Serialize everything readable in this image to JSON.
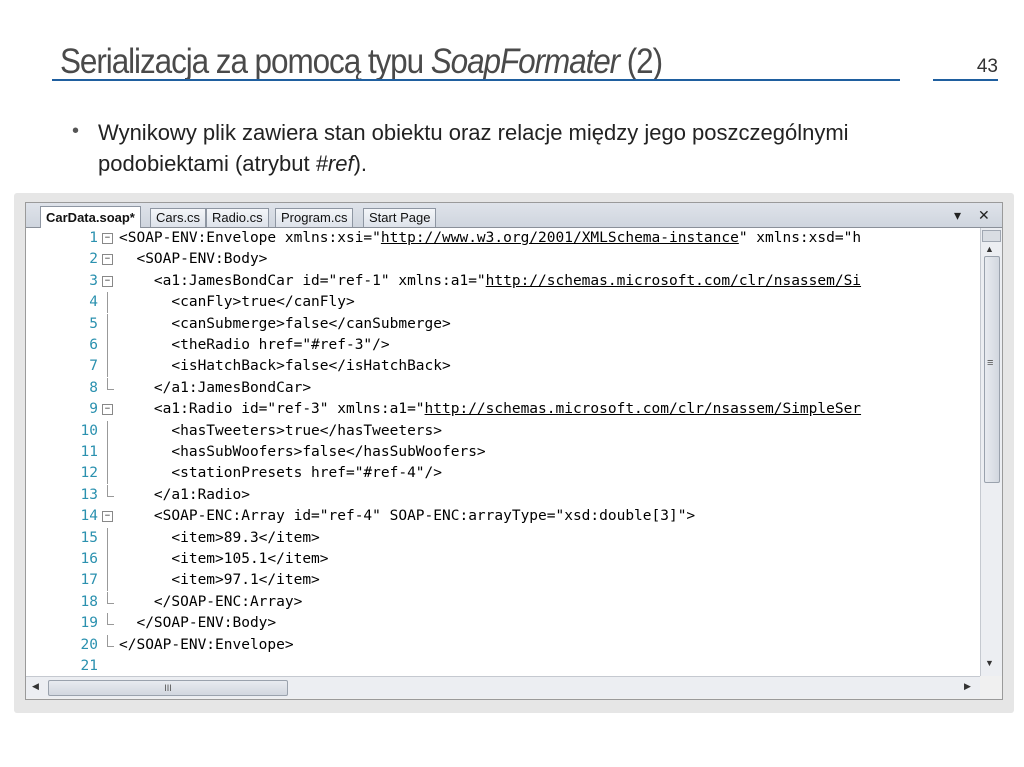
{
  "slide": {
    "title_plain_1": "Serializacja za pomocą typu ",
    "title_italic": "SoapFormater",
    "title_plain_2": " (2)",
    "slide_number": "43",
    "bullet_marker": "•",
    "bullet_text_1": "Wynikowy plik zawiera stan obiektu oraz relacje między jego poszczególnymi podobiektami (atrybut ",
    "bullet_italic": "#ref",
    "bullet_text_2": ")."
  },
  "editor": {
    "tabs": [
      {
        "label": "CarData.soap*",
        "active": true
      },
      {
        "label": "Cars.cs",
        "active": false
      },
      {
        "label": "Radio.cs",
        "active": false
      },
      {
        "label": "Program.cs",
        "active": false
      },
      {
        "label": "Start Page",
        "active": false
      }
    ],
    "dropdown_glyph": "▾",
    "close_glyph": "✕",
    "hscroll_grip": "III",
    "vscroll_grip": "≡",
    "lines": [
      {
        "n": "1",
        "pre": "<SOAP-ENV:Envelope xmlns:xsi=\"",
        "url": "http://www.w3.org/2001/XMLSchema-instance",
        "post": "\" xmlns:xsd=\"h",
        "fold": "minus"
      },
      {
        "n": "2",
        "pre": "  <SOAP-ENV:Body>",
        "fold": "minus"
      },
      {
        "n": "3",
        "pre": "    <a1:JamesBondCar id=\"ref-1\" xmlns:a1=\"",
        "url": "http://schemas.microsoft.com/clr/nsassem/Si",
        "fold": "minus"
      },
      {
        "n": "4",
        "pre": "      <canFly>true</canFly>"
      },
      {
        "n": "5",
        "pre": "      <canSubmerge>false</canSubmerge>"
      },
      {
        "n": "6",
        "pre": "      <theRadio href=\"#ref-3\"/>"
      },
      {
        "n": "7",
        "pre": "      <isHatchBack>false</isHatchBack>"
      },
      {
        "n": "8",
        "pre": "    </a1:JamesBondCar>",
        "fold": "end"
      },
      {
        "n": "9",
        "pre": "    <a1:Radio id=\"ref-3\" xmlns:a1=\"",
        "url": "http://schemas.microsoft.com/clr/nsassem/SimpleSer",
        "fold": "minus"
      },
      {
        "n": "10",
        "pre": "      <hasTweeters>true</hasTweeters>"
      },
      {
        "n": "11",
        "pre": "      <hasSubWoofers>false</hasSubWoofers>"
      },
      {
        "n": "12",
        "pre": "      <stationPresets href=\"#ref-4\"/>"
      },
      {
        "n": "13",
        "pre": "    </a1:Radio>",
        "fold": "end"
      },
      {
        "n": "14",
        "pre": "    <SOAP-ENC:Array id=\"ref-4\" SOAP-ENC:arrayType=\"xsd:double[3]\">",
        "fold": "minus"
      },
      {
        "n": "15",
        "pre": "      <item>89.3</item>"
      },
      {
        "n": "16",
        "pre": "      <item>105.1</item>"
      },
      {
        "n": "17",
        "pre": "      <item>97.1</item>"
      },
      {
        "n": "18",
        "pre": "    </SOAP-ENC:Array>",
        "fold": "end"
      },
      {
        "n": "19",
        "pre": "  </SOAP-ENV:Body>",
        "fold": "end"
      },
      {
        "n": "20",
        "pre": "</SOAP-ENV:Envelope>",
        "fold": "end"
      },
      {
        "n": "21",
        "pre": ""
      }
    ]
  }
}
